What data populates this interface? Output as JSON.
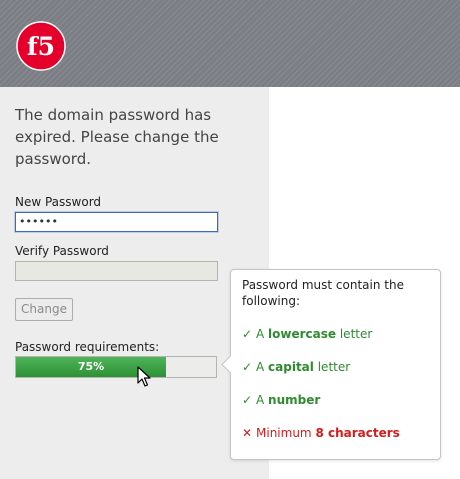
{
  "brand": {
    "logo_text": "f5",
    "logo_color": "#e4002b"
  },
  "message": "The domain password has expired. Please change the password.",
  "form": {
    "new_password_label": "New Password",
    "new_password_value": "••••••",
    "verify_password_label": "Verify Password",
    "verify_password_value": "",
    "change_button_label": "Change"
  },
  "requirements": {
    "label": "Password requirements:",
    "progress_percent": 75,
    "progress_text": "75%",
    "progress_color": "#35a03e"
  },
  "tooltip": {
    "title": "Password must contain the following:",
    "items": [
      {
        "status": "met",
        "mark": "✓",
        "pre": "A ",
        "strong": "lowercase",
        "post": " letter"
      },
      {
        "status": "met",
        "mark": "✓",
        "pre": "A ",
        "strong": "capital",
        "post": " letter"
      },
      {
        "status": "met",
        "mark": "✓",
        "pre": "A ",
        "strong": "number",
        "post": ""
      },
      {
        "status": "unmet",
        "mark": "✕",
        "pre": "Minimum ",
        "strong": "8 characters",
        "post": ""
      }
    ],
    "colors": {
      "met": "#2e8b2e",
      "unmet": "#d51b1b"
    }
  }
}
